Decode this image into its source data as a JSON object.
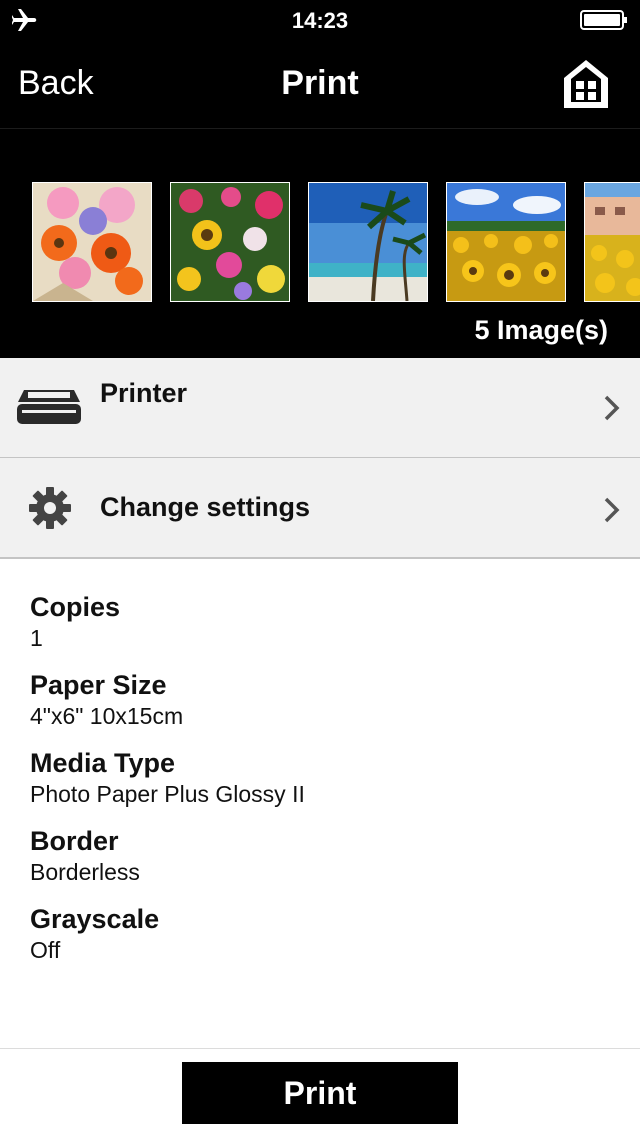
{
  "status": {
    "time": "14:23",
    "left_icon": "airplane-icon",
    "right_icon": "battery-icon"
  },
  "nav": {
    "back_label": "Back",
    "title": "Print",
    "home_icon": "home-icon"
  },
  "images": {
    "count_label": "5 Image(s)",
    "thumbnails": [
      "flower-bouquet",
      "garden-flowers",
      "tropical-beach",
      "sunflower-field",
      "sunflower-house"
    ]
  },
  "rows": {
    "printer_label": "Printer",
    "settings_label": "Change settings"
  },
  "settings": [
    {
      "name": "Copies",
      "value": "1"
    },
    {
      "name": "Paper Size",
      "value": "4\"x6\" 10x15cm"
    },
    {
      "name": "Media Type",
      "value": "Photo Paper Plus Glossy II"
    },
    {
      "name": "Border",
      "value": "Borderless"
    },
    {
      "name": "Grayscale",
      "value": "Off"
    }
  ],
  "footer": {
    "print_label": "Print"
  },
  "colors": {
    "bar_background": "#000000",
    "row_background": "#f1f1f1",
    "divider": "#c4c4c4"
  }
}
